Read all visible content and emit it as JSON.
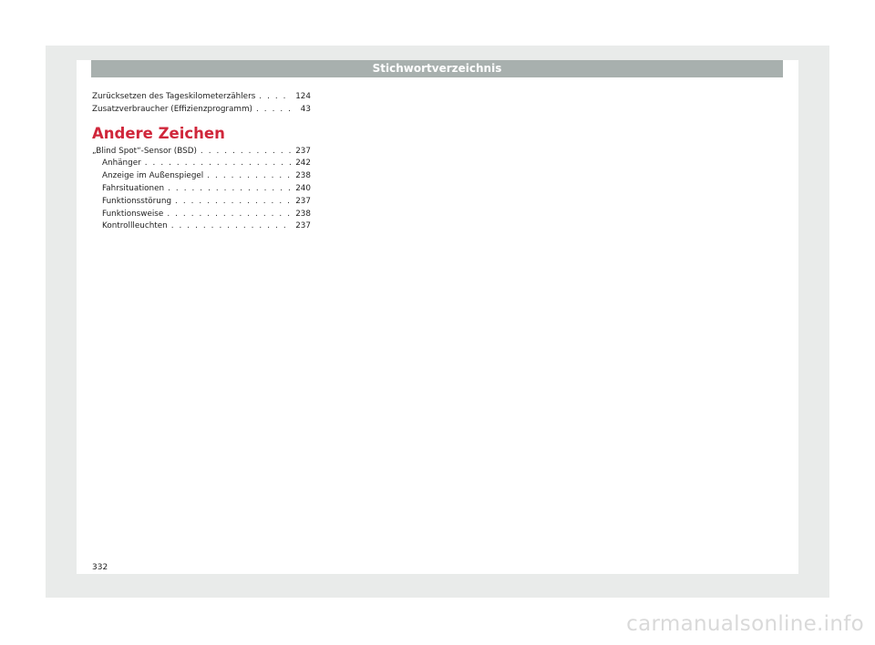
{
  "header": {
    "title": "Stichwortverzeichnis"
  },
  "top_entries": [
    {
      "term": "Zurücksetzen des Tageskilometerzählers",
      "page": "124"
    },
    {
      "term": "Zusatzverbraucher (Effizienzprogramm)",
      "page": "43"
    }
  ],
  "section": {
    "heading": "Andere Zeichen",
    "main_entry": {
      "term": "„Blind Spot“-Sensor (BSD)",
      "page": "237"
    },
    "sub_entries": [
      {
        "term": "Anhänger",
        "page": "242"
      },
      {
        "term": "Anzeige im Außenspiegel",
        "page": "238"
      },
      {
        "term": "Fahrsituationen",
        "page": "240"
      },
      {
        "term": "Funktionsstörung",
        "page": "237"
      },
      {
        "term": "Funktionsweise",
        "page": "238"
      },
      {
        "term": "Kontrollleuchten",
        "page": "237"
      }
    ]
  },
  "footer": {
    "page_number": "332"
  },
  "watermark": {
    "text": "carmanualsonline.info"
  }
}
